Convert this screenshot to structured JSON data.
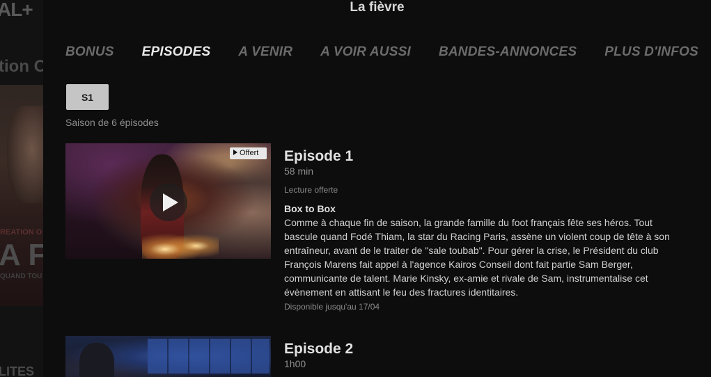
{
  "background": {
    "logo": "AL+",
    "heading": "tion O",
    "poster_credit": "REATION O",
    "poster_title": "A FI",
    "poster_sub": "QUAND TOU",
    "bottom_text": "LITES"
  },
  "modal": {
    "title": "La fièvre",
    "tabs": [
      {
        "label": "BONUS",
        "active": false
      },
      {
        "label": "EPISODES",
        "active": true
      },
      {
        "label": "A VENIR",
        "active": false
      },
      {
        "label": "A VOIR AUSSI",
        "active": false
      },
      {
        "label": "BANDES-ANNONCES",
        "active": false
      },
      {
        "label": "PLUS D'INFOS",
        "active": false
      }
    ],
    "season_button": "S1",
    "season_info": "Saison de 6 épisodes",
    "episodes": [
      {
        "title": "Episode 1",
        "duration": "58 min",
        "status": "Lecture offerte",
        "badge": "Offert",
        "name": "Box to Box",
        "description": "Comme à chaque fin de saison, la grande famille du foot français fête ses héros. Tout bascule quand Fodé Thiam, la star du Racing Paris, assène un violent coup de tête à son entraîneur, avant de le traiter de \"sale toubab\". Pour gérer la crise, le Président du club François Marens fait appel à l'agence Kairos Conseil dont fait partie Sam Berger, communicante de talent. Marie Kinsky, ex-amie et rivale de Sam, instrumentalise cet évènement en attisant le feu des fractures identitaires.",
        "availability": "Disponible jusqu'au 17/04"
      },
      {
        "title": "Episode 2",
        "duration": "1h00"
      }
    ]
  },
  "icons": {
    "play": "play-icon",
    "badge_play": "play-small-icon"
  }
}
